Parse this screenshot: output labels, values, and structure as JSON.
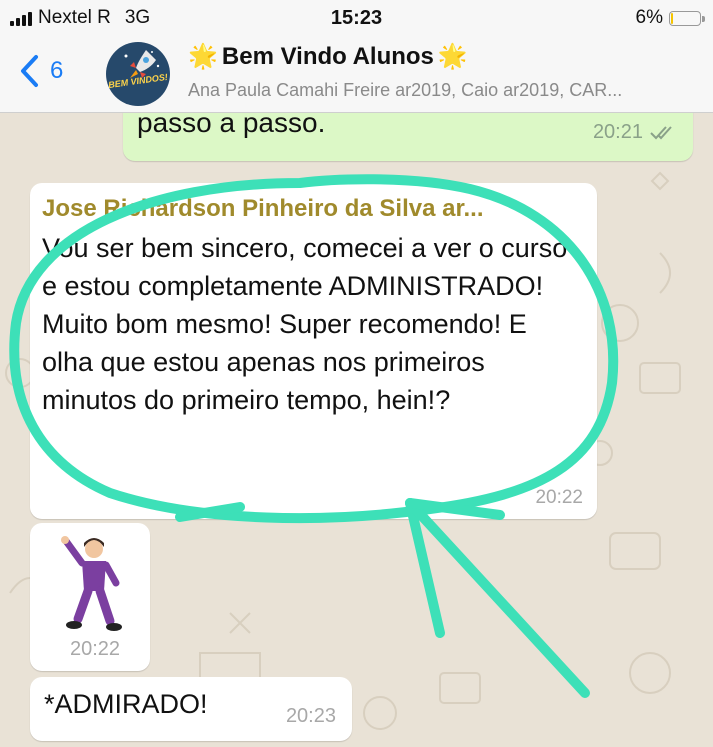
{
  "status_bar": {
    "carrier": "Nextel R",
    "network": "3G",
    "time": "15:23",
    "battery": "6%",
    "battery_level": 0.06
  },
  "header": {
    "back_count": "6",
    "avatar_text": "BEM VINDOS!",
    "title": "Bem Vindo Alunos",
    "title_emoji": "🌟",
    "subtitle": "Ana Paula Camahi Freire ar2019, Caio ar2019, CAR..."
  },
  "messages": {
    "outgoing": {
      "text": "passo a passo.",
      "time": "20:21"
    },
    "incoming": {
      "sender": "Jose Richardson Pinheiro da Silva ar...",
      "text": "Vou ser bem sincero, comecei a ver o curso e estou completamente ADMINISTRADO! Muito bom mesmo! Super recomendo! E olha que estou apenas nos primeiros minutos do primeiro tempo, hein!?",
      "time": "20:22"
    },
    "sticker": {
      "time": "20:22"
    },
    "correction": {
      "text": "*ADMIRADO!",
      "time": "20:23"
    }
  },
  "colors": {
    "accent": "#1a7cf5",
    "outgoing_bubble": "#dcf8c6",
    "sender_name": "#a08a2c",
    "annotation": "#3de0b8"
  }
}
